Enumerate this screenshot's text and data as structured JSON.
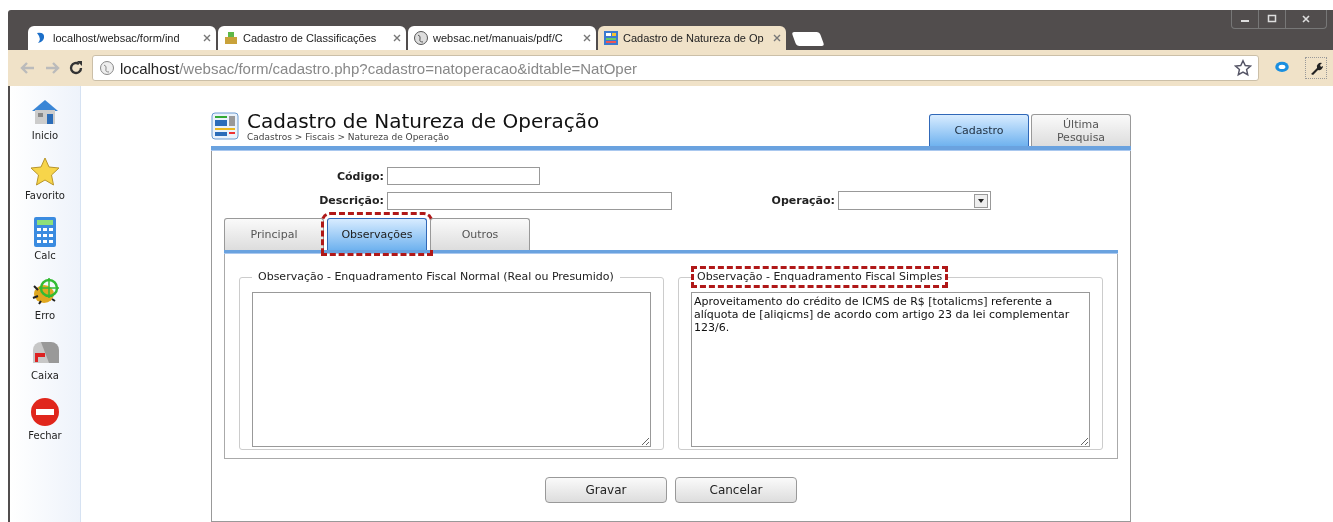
{
  "browser_tabs": [
    {
      "title": "localhost/websac/form/ind",
      "kind": "swirl",
      "selected": false
    },
    {
      "title": "Cadastro de Classificações",
      "kind": "box",
      "selected": false
    },
    {
      "title": "websac.net/manuais/pdf/C",
      "kind": "globe",
      "selected": false
    },
    {
      "title": "Cadastro de Natureza de Op",
      "kind": "grid",
      "selected": true
    }
  ],
  "address_bar": {
    "host": "localhost",
    "path": "/websac/form/cadastro.php?cadastro=natoperacao&idtable=NatOper"
  },
  "sidebar": {
    "items": [
      {
        "label": "Inicio",
        "kind": "home"
      },
      {
        "label": "Favorito",
        "kind": "star"
      },
      {
        "label": "Calc",
        "kind": "calc"
      },
      {
        "label": "Erro",
        "kind": "bug"
      },
      {
        "label": "Caixa",
        "kind": "mailbox"
      },
      {
        "label": "Fechar",
        "kind": "stop"
      }
    ]
  },
  "page": {
    "title": "Cadastro de Natureza de Operação",
    "breadcrumb": "Cadastros > Fiscais > Natureza de Operação",
    "tabs": [
      {
        "label": "Cadastro",
        "selected": true
      },
      {
        "label": "Última Pesquisa",
        "selected": false
      }
    ]
  },
  "form": {
    "fields": [
      {
        "label": "Código:",
        "kind": "text"
      },
      {
        "label": "Descrição:",
        "kind": "text"
      },
      {
        "label": "Operação:",
        "kind": "select"
      }
    ],
    "tabs": [
      {
        "label": "Principal",
        "selected": false,
        "highlighted": false
      },
      {
        "label": "Observações",
        "selected": true,
        "highlighted": true
      },
      {
        "label": "Outros",
        "selected": false,
        "highlighted": false
      }
    ],
    "observations": [
      {
        "legend": "Observação - Enquadramento Fiscal Normal (Real ou Presumido)",
        "highlighted": false
      },
      {
        "legend": "Observação - Enquadramento Fiscal Simples",
        "value": "Aproveitamento do crédito de ICMS de R$ [totalicms] referente a alíquota de [aliqicms] de acordo com artigo 23 da lei complementar 123/6.",
        "highlighted": true
      }
    ],
    "buttons": [
      "Gravar",
      "Cancelar"
    ]
  }
}
